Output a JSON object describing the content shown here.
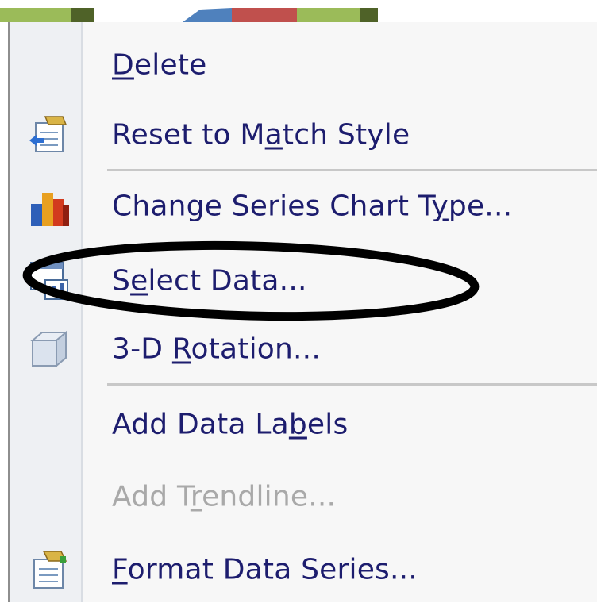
{
  "menu": {
    "items": [
      {
        "label_pre": "",
        "label_key": "D",
        "label_post": "elete",
        "icon": "none",
        "disabled": false
      },
      {
        "label_pre": "Reset to M",
        "label_key": "a",
        "label_post": "tch Style",
        "icon": "reset-style-icon",
        "disabled": false
      },
      {
        "label_pre": "Change Series Chart T",
        "label_key": "y",
        "label_post": "pe...",
        "icon": "bar-chart-icon",
        "disabled": false
      },
      {
        "label_pre": "S",
        "label_key": "e",
        "label_post": "lect Data...",
        "icon": "select-data-icon",
        "disabled": false
      },
      {
        "label_pre": "3-D ",
        "label_key": "R",
        "label_post": "otation...",
        "icon": "cube-icon",
        "disabled": false
      },
      {
        "label_pre": "Add Data La",
        "label_key": "b",
        "label_post": "els",
        "icon": "none",
        "disabled": false
      },
      {
        "label_pre": "Add T",
        "label_key": "r",
        "label_post": "endline...",
        "icon": "none",
        "disabled": true
      },
      {
        "label_pre": "",
        "label_key": "F",
        "label_post": "ormat Data Series...",
        "icon": "format-series-icon",
        "disabled": false
      }
    ]
  },
  "colors": {
    "menu_bg": "#f7f7f7",
    "icon_column_bg": "#eef0f3",
    "text": "#1d1d6e",
    "disabled_text": "#a9a9a9",
    "chart_green": "#9bbb59",
    "chart_blue": "#4f81bd",
    "chart_red": "#c0504d",
    "highlight_ellipse": "#000000"
  }
}
